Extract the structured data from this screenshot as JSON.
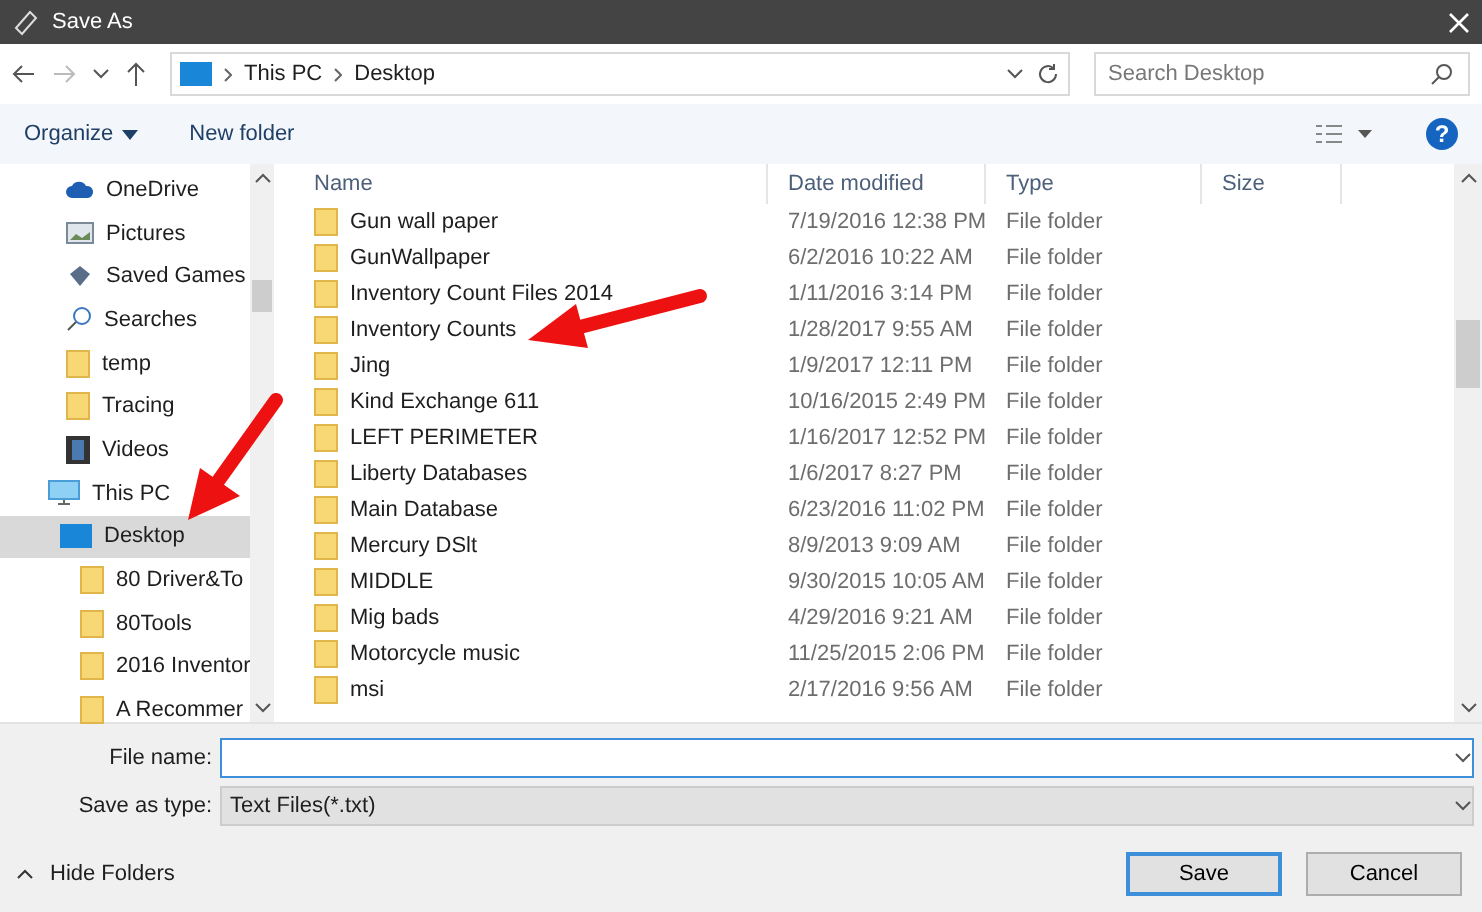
{
  "window": {
    "title": "Save As"
  },
  "address": {
    "path": [
      {
        "label": "This PC"
      },
      {
        "label": "Desktop"
      }
    ],
    "search_placeholder": "Search Desktop"
  },
  "toolbar": {
    "organize": "Organize",
    "new_folder": "New folder",
    "help": "?"
  },
  "nav": {
    "items": [
      {
        "label": "OneDrive",
        "kind": "cloud",
        "selected": false
      },
      {
        "label": "Pictures",
        "kind": "pictures",
        "selected": false
      },
      {
        "label": "Saved Games",
        "kind": "games",
        "selected": false
      },
      {
        "label": "Searches",
        "kind": "search",
        "selected": false
      },
      {
        "label": "temp",
        "kind": "folder",
        "selected": false
      },
      {
        "label": "Tracing",
        "kind": "folder",
        "selected": false
      },
      {
        "label": "Videos",
        "kind": "videos",
        "selected": false
      },
      {
        "label": "This PC",
        "kind": "pc",
        "selected": false,
        "children": [
          {
            "label": "Desktop",
            "kind": "desktop",
            "selected": true,
            "children": [
              {
                "label": "80 Driver&To",
                "kind": "folder",
                "selected": false
              },
              {
                "label": "80Tools",
                "kind": "folder",
                "selected": false
              },
              {
                "label": "2016 Inventor",
                "kind": "folder",
                "selected": false
              },
              {
                "label": "A Recommer",
                "kind": "folder",
                "selected": false
              }
            ]
          }
        ]
      }
    ]
  },
  "table": {
    "columns": [
      "Name",
      "Date modified",
      "Type",
      "Size"
    ],
    "rows": [
      {
        "name": "Gun wall paper",
        "date": "7/19/2016 12:38 PM",
        "type": "File folder"
      },
      {
        "name": "GunWallpaper",
        "date": "6/2/2016 10:22 AM",
        "type": "File folder"
      },
      {
        "name": "Inventory Count Files 2014",
        "date": "1/11/2016 3:14 PM",
        "type": "File folder"
      },
      {
        "name": "Inventory Counts",
        "date": "1/28/2017 9:55 AM",
        "type": "File folder"
      },
      {
        "name": "Jing",
        "date": "1/9/2017 12:11 PM",
        "type": "File folder"
      },
      {
        "name": "Kind Exchange 611",
        "date": "10/16/2015 2:49 PM",
        "type": "File folder"
      },
      {
        "name": "LEFT PERIMETER",
        "date": "1/16/2017 12:52 PM",
        "type": "File folder"
      },
      {
        "name": "Liberty Databases",
        "date": "1/6/2017 8:27 PM",
        "type": "File folder"
      },
      {
        "name": "Main Database",
        "date": "6/23/2016 11:02 PM",
        "type": "File folder"
      },
      {
        "name": "Mercury DSlt",
        "date": "8/9/2013 9:09 AM",
        "type": "File folder"
      },
      {
        "name": "MIDDLE",
        "date": "9/30/2015 10:05 AM",
        "type": "File folder"
      },
      {
        "name": "Mig bads",
        "date": "4/29/2016 9:21 AM",
        "type": "File folder"
      },
      {
        "name": "Motorcycle music",
        "date": "11/25/2015 2:06 PM",
        "type": "File folder"
      },
      {
        "name": "msi",
        "date": "2/17/2016 9:56 AM",
        "type": "File folder"
      }
    ]
  },
  "form": {
    "file_name_label": "File name:",
    "save_type_label": "Save as type:",
    "save_type_value": "Text Files(*.txt)"
  },
  "footer": {
    "hide_folders": "Hide Folders",
    "buttons": [
      {
        "label": "Save",
        "kind": "primary"
      },
      {
        "label": "Cancel",
        "kind": "normal"
      }
    ]
  }
}
